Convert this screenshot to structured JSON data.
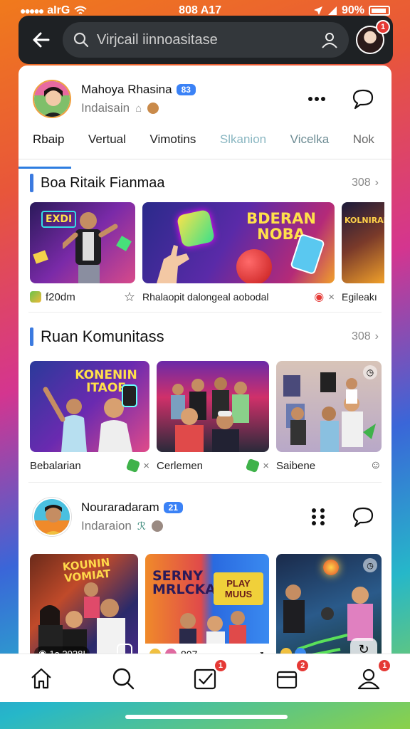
{
  "status": {
    "time": "808 A17",
    "battery": "90%",
    "carrier": "aIrG"
  },
  "search": {
    "placeholder": "Virjcail iinnoasitase"
  },
  "top_badge": "1",
  "profile1": {
    "name": "Mahoya Rhasina",
    "chip": "83",
    "subtitle": "Indaisain"
  },
  "tabs": [
    "Rbaip",
    "Vertual",
    "Vimotins",
    "Slkanion",
    "Vicelka",
    "Nok"
  ],
  "section1": {
    "title": "Boa Ritaik Fianmaa",
    "more": "308",
    "cards": [
      {
        "caption": "f20dm",
        "thumb_text": "EXDI"
      },
      {
        "caption": "Rhalaopit dalongeal aobodal",
        "thumb_text": "BDERAN NOBA"
      },
      {
        "caption": "Egileakı",
        "thumb_text": "KOLNIRAN"
      }
    ]
  },
  "section2": {
    "title": "Ruan Komunitass",
    "more": "308",
    "cards": [
      {
        "caption": "Bebalarian",
        "thumb_text": "KONENIN ITAOE"
      },
      {
        "caption": "Cerlemen"
      },
      {
        "caption": "Saibene"
      }
    ]
  },
  "profile2": {
    "name": "Nouraradaram",
    "chip": "21",
    "subtitle": "Indaraion"
  },
  "section3": {
    "cards": [
      {
        "caption": "1a 2028I",
        "thumb_text": "KOUNIN VOMIAT"
      },
      {
        "caption": "807",
        "thumb_text": "SERNY MRLCKA"
      },
      {
        "caption": ""
      }
    ]
  },
  "nav": {
    "badges": {
      "check": "1",
      "box": "2",
      "profile": "1"
    }
  },
  "colors": {
    "accent": "#3b7ae0",
    "badge": "#e53935",
    "topbar": "#1e2124"
  }
}
